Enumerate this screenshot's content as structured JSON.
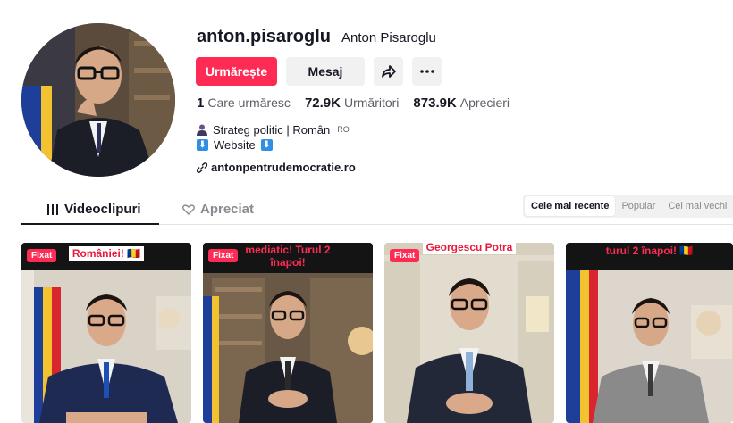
{
  "profile": {
    "username": "anton.pisaroglu",
    "display_name": "Anton Pisaroglu",
    "avatar_icon": "profile-photo"
  },
  "buttons": {
    "follow": "Urmărește",
    "message": "Mesaj",
    "share_icon": "share-arrow-icon",
    "more_icon": "more-dots-icon"
  },
  "stats": [
    {
      "value": "1",
      "label": "Care urmăresc"
    },
    {
      "value": "72.9K",
      "label": "Urmăritori"
    },
    {
      "value": "873.9K",
      "label": "Aprecieri"
    }
  ],
  "bio": {
    "line1": "Strateg politic | Român",
    "line1_flag": "RO",
    "line2": "Website",
    "arrow_glyph": "⬇"
  },
  "link": "antonpentrudemocratie.ro",
  "tabs": {
    "videos": "Videoclipuri",
    "liked": "Apreciat"
  },
  "sort": {
    "latest": "Cele mai recente",
    "popular": "Popular",
    "oldest": "Cel mai vechi"
  },
  "videos": [
    {
      "pinned": "Fixat",
      "caption": "României! 🇷🇴"
    },
    {
      "pinned": "Fixat",
      "caption": "mediatic! Turul 2 înapoi!"
    },
    {
      "pinned": "Fixat",
      "caption": "Georgescu Potra"
    },
    {
      "pinned": "",
      "caption": "turul 2 înapoi! 🇷🇴"
    }
  ],
  "colors": {
    "accent": "#fe2c55",
    "text": "#161823",
    "muted": "#5d5e66",
    "button_bg": "#f1f1f2"
  }
}
